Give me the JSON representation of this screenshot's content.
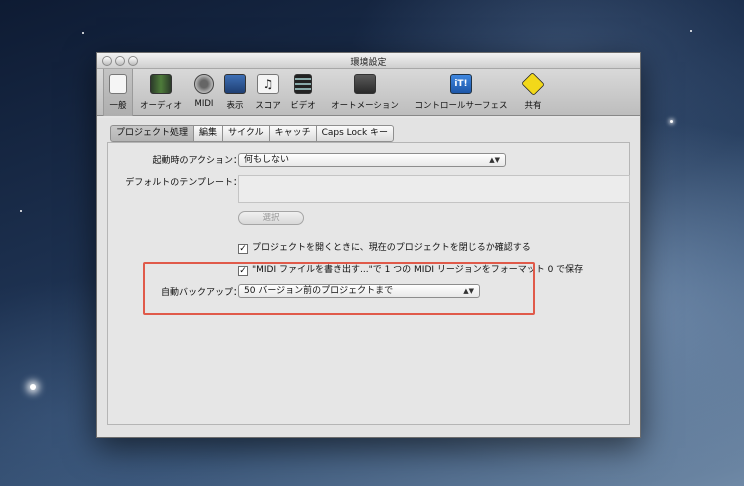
{
  "window": {
    "title": "環境設定"
  },
  "toolbar": {
    "items": [
      {
        "label": "一般",
        "icon": "general-icon"
      },
      {
        "label": "オーディオ",
        "icon": "audio-icon"
      },
      {
        "label": "MIDI",
        "icon": "midi-icon"
      },
      {
        "label": "表示",
        "icon": "display-icon"
      },
      {
        "label": "スコア",
        "icon": "score-icon"
      },
      {
        "label": "ビデオ",
        "icon": "video-icon"
      },
      {
        "label": "オートメーション",
        "icon": "automation-icon"
      },
      {
        "label": "コントロールサーフェス",
        "icon": "control-surface-icon"
      },
      {
        "label": "共有",
        "icon": "sharing-icon"
      }
    ]
  },
  "tabs": [
    "プロジェクト処理",
    "編集",
    "サイクル",
    "キャッチ",
    "Caps Lock キー"
  ],
  "form": {
    "startup_action_label": "起動時のアクション：",
    "startup_action_value": "何もしない",
    "default_template_label": "デフォルトのテンプレート：",
    "select_button": "選択",
    "confirm_close_label": "プロジェクトを開くときに、現在のプロジェクトを閉じるか確認する",
    "midi_export_label": "\"MIDI ファイルを書き出す...\"で 1 つの MIDI リージョンをフォーマット 0 で保存",
    "auto_backup_label": "自動バックアップ：",
    "auto_backup_value": "50 バージョン前のプロジェクトまで"
  },
  "colors": {
    "highlight": "#e05a4a"
  }
}
